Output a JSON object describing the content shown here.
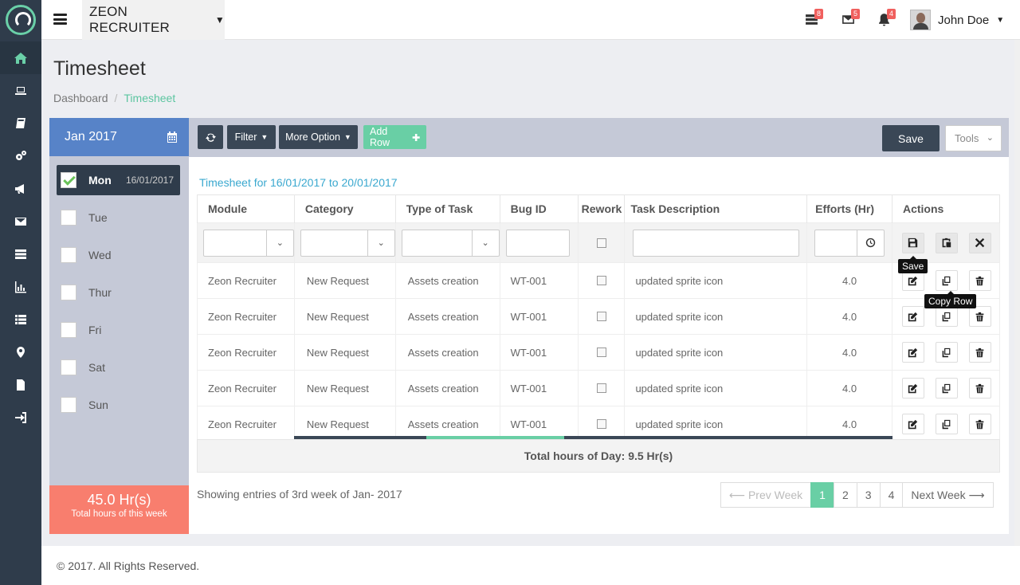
{
  "app": {
    "brand": "ZEON RECRUITER",
    "user": "John Doe"
  },
  "notifications": {
    "tasks": "8",
    "mail": "5",
    "alerts": "4"
  },
  "page": {
    "title": "Timesheet",
    "breadcrumb": [
      "Dashboard",
      "Timesheet"
    ]
  },
  "sidebar": {
    "month": "Jan 2017",
    "days": [
      {
        "label": "Mon",
        "date": "16/01/2017",
        "active": true
      },
      {
        "label": "Tue",
        "date": ""
      },
      {
        "label": "Wed",
        "date": ""
      },
      {
        "label": "Thur",
        "date": ""
      },
      {
        "label": "Fri",
        "date": ""
      },
      {
        "label": "Sat",
        "date": ""
      },
      {
        "label": "Sun",
        "date": ""
      }
    ],
    "total_value": "45.0 Hr(s)",
    "total_label": "Total hours of this week"
  },
  "toolbar": {
    "filter": "Filter",
    "more": "More Option",
    "add_row": "Add Row",
    "save": "Save",
    "tools": "Tools"
  },
  "timesheet_title": "Timesheet for 16/01/2017 to 20/01/2017",
  "table": {
    "headers": [
      "Module",
      "Category",
      "Type of Task",
      "Bug ID",
      "Rework",
      "Task Description",
      "Efforts (Hr)",
      "Actions"
    ],
    "rows": [
      [
        "Zeon Recruiter",
        "New Request",
        "Assets creation",
        "WT-001",
        "",
        "updated sprite icon",
        "4.0"
      ],
      [
        "Zeon Recruiter",
        "New Request",
        "Assets creation",
        "WT-001",
        "",
        "updated sprite icon",
        "4.0"
      ],
      [
        "Zeon Recruiter",
        "New Request",
        "Assets creation",
        "WT-001",
        "",
        "updated sprite icon",
        "4.0"
      ],
      [
        "Zeon Recruiter",
        "New Request",
        "Assets creation",
        "WT-001",
        "",
        "updated sprite icon",
        "4.0"
      ],
      [
        "Zeon Recruiter",
        "New Request",
        "Assets creation",
        "WT-001",
        "",
        "updated sprite icon",
        "4.0"
      ]
    ]
  },
  "tooltips": {
    "save": "Save",
    "copy": "Copy Row"
  },
  "day_total": "Total hours of Day: 9.5 Hr(s)",
  "showing": "Showing entries of 3rd week of Jan- 2017",
  "pager": {
    "prev": "⟵ Prev Week",
    "pages": [
      "1",
      "2",
      "3",
      "4"
    ],
    "next": "Next Week ⟶"
  },
  "footer": "© 2017. All Rights Reserved."
}
